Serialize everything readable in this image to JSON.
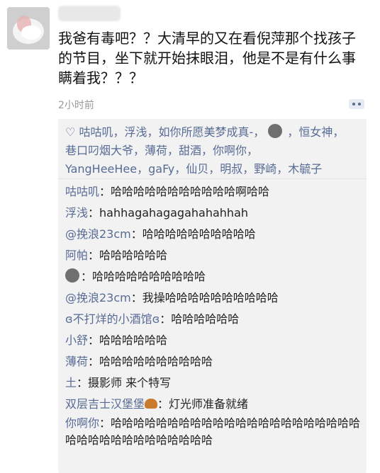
{
  "post": {
    "text": "我爸有毒吧？？大清早的又在看倪萍那个找孩子的节目，坐下就开始抹眼泪，他是不是有什么事瞒着我？？？",
    "time": "2小时前"
  },
  "likes": {
    "names_line1": "咕咕叽，浮浅，如你所愿美梦成真-，",
    "names_line1b": "，恒女神，",
    "names_line2": "巷口叼烟大爷，薄荷，甜酒，你啊你，",
    "names_line3": "YangHeeHee，gaFy，仙贝，明叔，野崎，木毓子"
  },
  "comments": [
    {
      "name": "咕咕叽",
      "text": "哈哈哈哈哈哈哈哈哈哈哈啊哈哈"
    },
    {
      "name": "浮浅",
      "text": "hahhagahagagahahahhah"
    },
    {
      "name": "@挽浪23cm",
      "text": "哈哈哈哈哈哈哈哈哈哈"
    },
    {
      "name": "阿帕",
      "text": "哈哈哈哈哈哈"
    },
    {
      "name": "",
      "text": "哈哈哈哈哈哈哈哈哈哈"
    },
    {
      "name": "@挽浪23cm",
      "text": "我操哈哈哈哈哈哈哈哈哈哈"
    },
    {
      "name": "ɞ不打烊的小酒馆ɞ",
      "text": "哈哈哈哈哈哈"
    },
    {
      "name": "小舒",
      "text": "哈哈哈哈哈哈"
    },
    {
      "name": "薄荷",
      "text": "哈哈哈哈哈哈哈哈哈哈"
    },
    {
      "name": "土",
      "text": "摄影师 来个特写"
    },
    {
      "name": "双层吉士汉堡堡",
      "text": "灯光师准备就绪"
    },
    {
      "name": "你啊你",
      "text": "哈哈哈哈哈哈哈哈哈哈哈哈哈哈哈哈哈哈哈哈哈哈哈哈哈哈哈哈哈哈哈哈哈哈哈"
    }
  ]
}
